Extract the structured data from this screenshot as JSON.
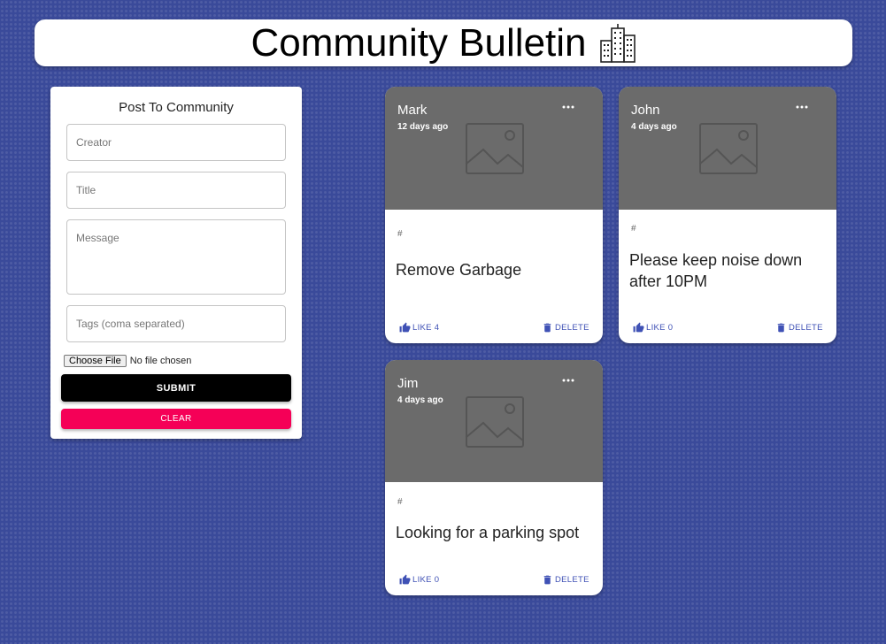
{
  "header": {
    "title": "Community Bulletin",
    "icon": "city-building-icon"
  },
  "form": {
    "title": "Post To Community",
    "creator_placeholder": "Creator",
    "title_placeholder": "Title",
    "message_placeholder": "Message",
    "tags_placeholder": "Tags (coma separated)",
    "file_button": "Choose File",
    "file_status": "No file chosen",
    "submit_label": "SUBMIT",
    "clear_label": "CLEAR"
  },
  "posts": [
    {
      "creator": "Mark",
      "time": "12 days ago",
      "tags": "#",
      "message": "Remove Garbage",
      "like_label": "LIKE 4",
      "delete_label": "DELETE"
    },
    {
      "creator": "John",
      "time": "4 days ago",
      "tags": "#",
      "message": "Please keep noise down after 10PM",
      "like_label": "LIKE 0",
      "delete_label": "DELETE"
    },
    {
      "creator": "Jim",
      "time": "4 days ago",
      "tags": "#",
      "message": "Looking for a parking spot",
      "like_label": "LIKE 0",
      "delete_label": "DELETE"
    }
  ],
  "colors": {
    "background": "#3a4a9a",
    "accent": "#3f51b5",
    "submit": "#000000",
    "clear": "#f50057",
    "card_media": "#6b6b6b"
  }
}
